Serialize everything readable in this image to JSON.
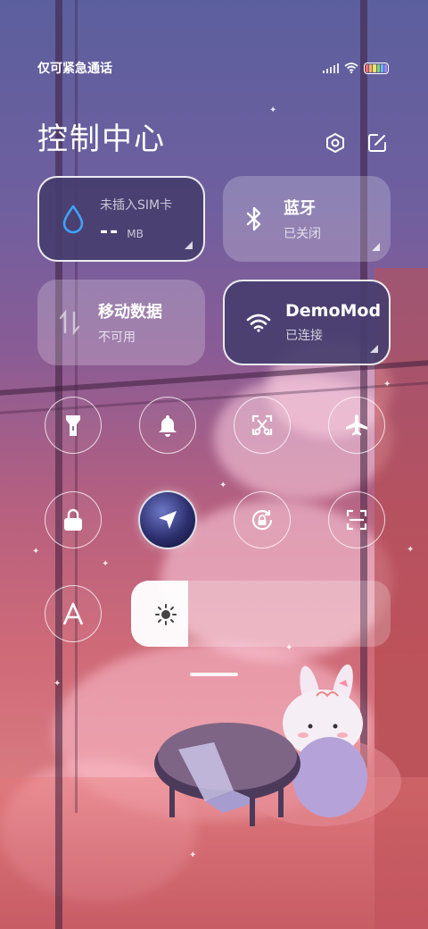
{
  "status_bar": {
    "carrier_text": "仅可紧急通话",
    "battery_colors": [
      "#f26d6d",
      "#f5b15a",
      "#f5e35a",
      "#7fd66e",
      "#67b6f2",
      "#9b86f0"
    ]
  },
  "header": {
    "title": "控制中心",
    "settings_icon": "gear-hex-icon",
    "edit_icon": "edit-icon"
  },
  "tiles": {
    "data_usage": {
      "label": "未插入SIM卡",
      "value": "--",
      "unit": "MB",
      "icon": "water-drop-icon",
      "accent": "#3fa2f7"
    },
    "bluetooth": {
      "label": "蓝牙",
      "status": "已关闭",
      "icon": "bluetooth-icon"
    },
    "mobile_data": {
      "label": "移动数据",
      "status": "不可用",
      "icon": "mobile-data-icon"
    },
    "wifi": {
      "label": "DemoMod",
      "status": "已连接",
      "icon": "wifi-icon"
    }
  },
  "toggles": [
    {
      "name": "flashlight",
      "icon": "flashlight-icon"
    },
    {
      "name": "ring",
      "icon": "bell-icon"
    },
    {
      "name": "screenshot",
      "icon": "screenshot-icon"
    },
    {
      "name": "airplane",
      "icon": "airplane-icon"
    },
    {
      "name": "lock-screen",
      "icon": "lock-icon"
    },
    {
      "name": "location",
      "icon": "location-arrow-icon"
    },
    {
      "name": "auto-rotate",
      "icon": "rotate-lock-icon"
    },
    {
      "name": "scan",
      "icon": "scan-icon"
    },
    {
      "name": "font-size",
      "icon": "font-a-icon"
    }
  ],
  "brightness": {
    "level": 0.22,
    "icon": "sun-icon"
  }
}
